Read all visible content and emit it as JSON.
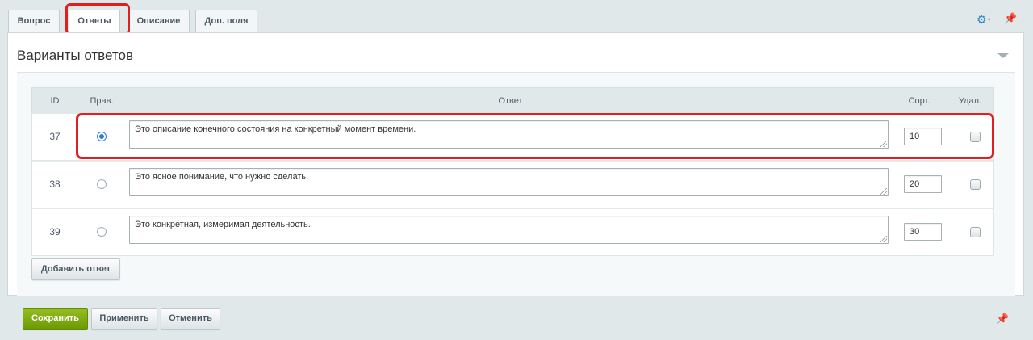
{
  "tabs": [
    {
      "label": "Вопрос"
    },
    {
      "label": "Ответы"
    },
    {
      "label": "Описание"
    },
    {
      "label": "Доп. поля"
    }
  ],
  "active_tab": "Ответы",
  "section": {
    "title": "Варианты ответов"
  },
  "table": {
    "headers": {
      "id": "ID",
      "correct": "Прав.",
      "answer": "Ответ",
      "sort": "Сорт.",
      "delete": "Удал."
    },
    "rows": [
      {
        "id": "37",
        "correct": true,
        "answer": "Это описание конечного состояния на конкретный момент времени.",
        "sort": "10",
        "delete": false
      },
      {
        "id": "38",
        "correct": false,
        "answer": "Это ясное понимание, что нужно сделать.",
        "sort": "20",
        "delete": false
      },
      {
        "id": "39",
        "correct": false,
        "answer": "Это конкретная, измеримая деятельность.",
        "sort": "30",
        "delete": false
      }
    ]
  },
  "buttons": {
    "add_answer": "Добавить ответ",
    "save": "Сохранить",
    "apply": "Применить",
    "cancel": "Отменить"
  },
  "icons": {
    "gear": "gear-icon",
    "pin": "pin-icon",
    "collapse": "chevron-down-icon"
  },
  "colors": {
    "highlight": "#e02020",
    "primary": "#7cab11",
    "radio": "#2e7ad1"
  }
}
